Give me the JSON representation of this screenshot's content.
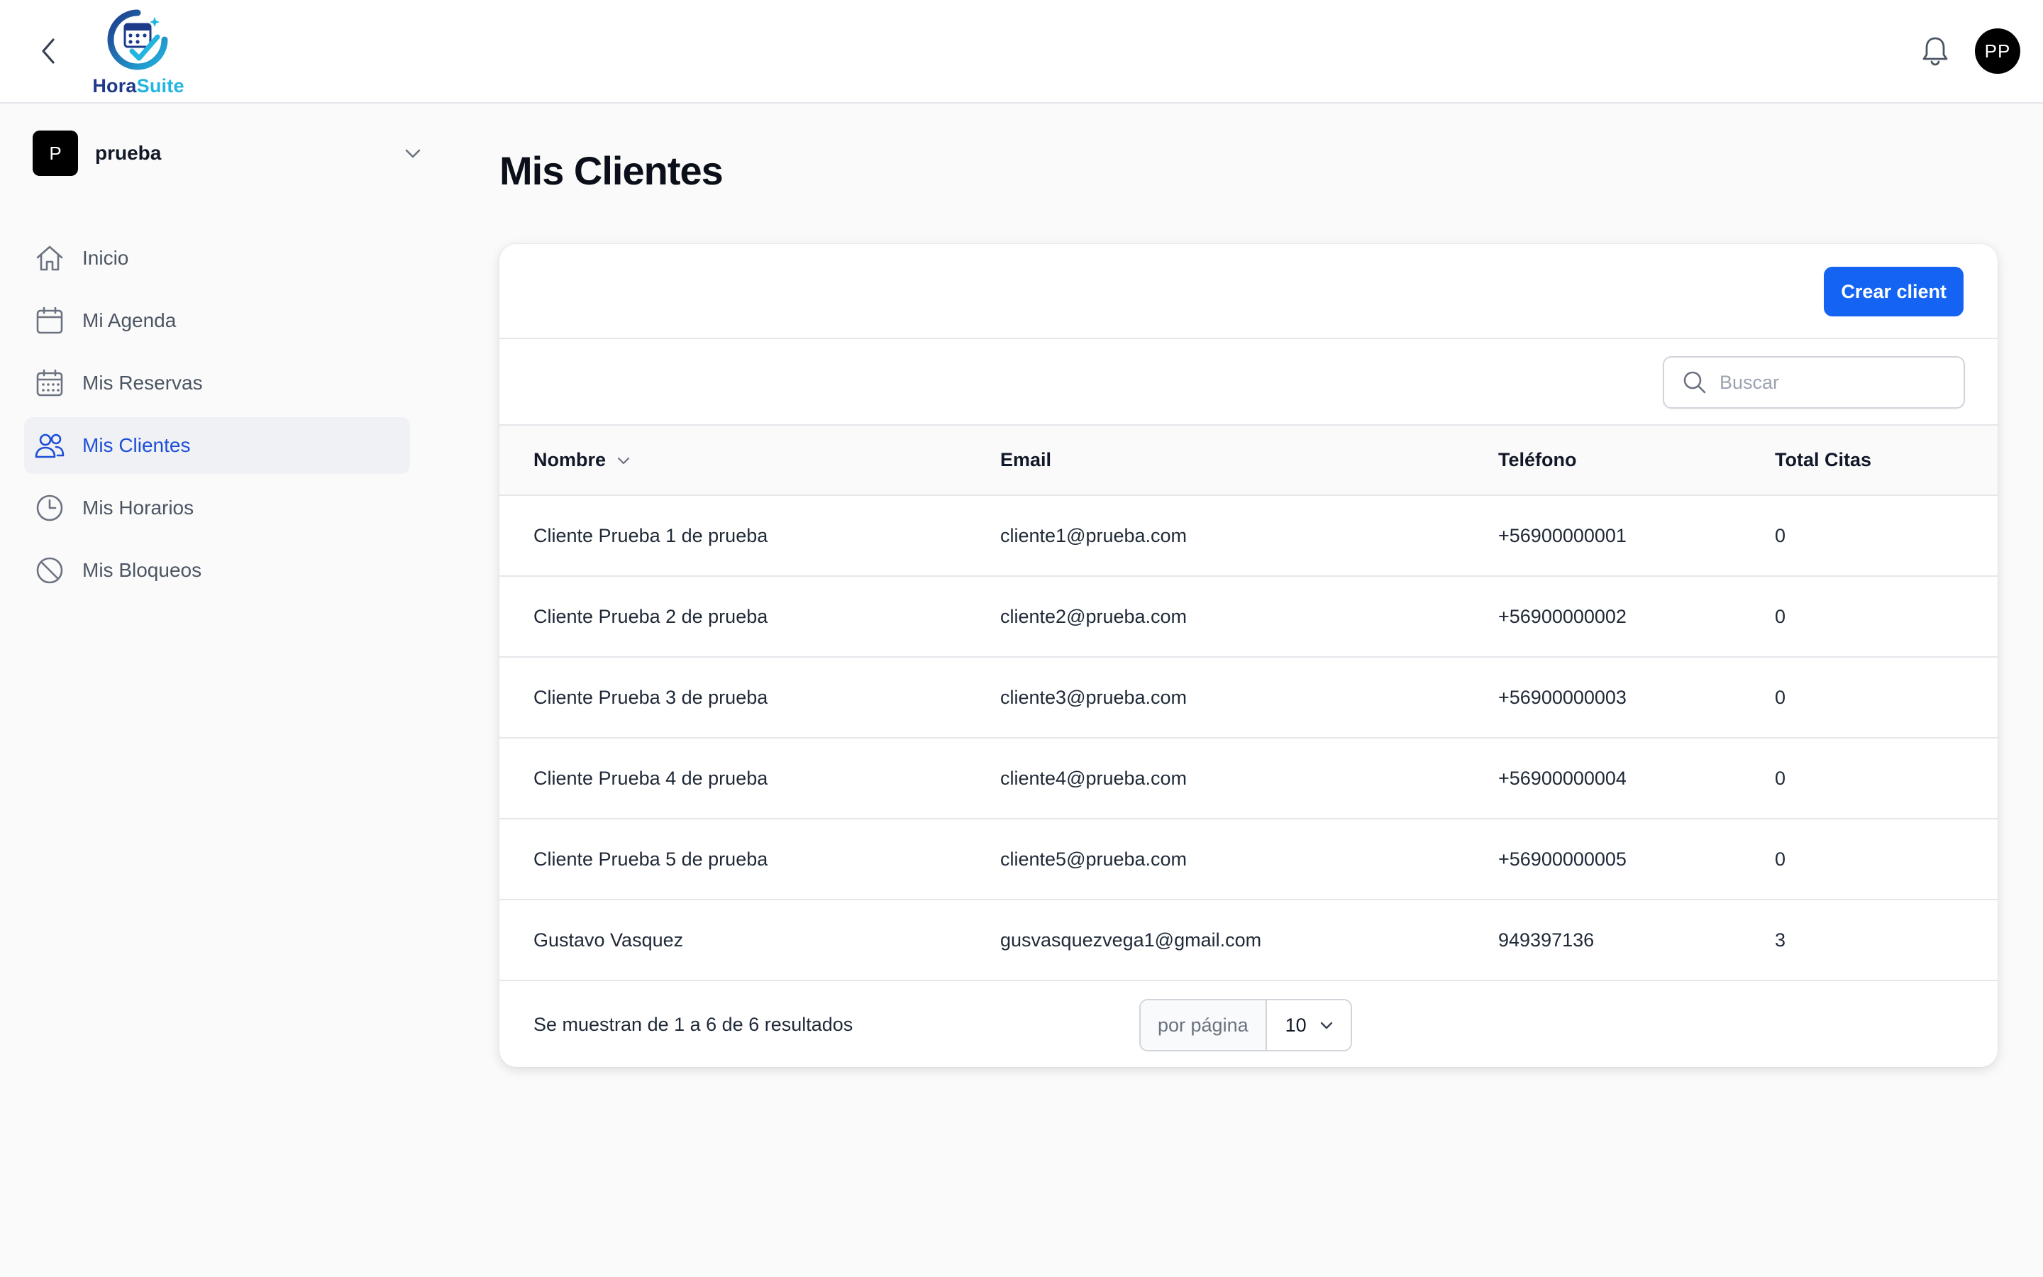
{
  "app": {
    "brand_part1": "Hora",
    "brand_part2": "Suite",
    "user_initials": "PP"
  },
  "colors": {
    "primary": "#1463f3",
    "active_nav": "#1d4ed8",
    "brand_dark": "#1e3a8a",
    "brand_light": "#22b5e0"
  },
  "icons": {
    "back": "chevron-left-icon",
    "notifications": "bell-icon",
    "workspace_toggle": "chevron-down-icon",
    "search": "search-icon",
    "sort": "chevron-down-icon",
    "per_page": "chevron-down-icon"
  },
  "workspace": {
    "initial": "P",
    "name": "prueba"
  },
  "sidebar": {
    "items": [
      {
        "label": "Inicio",
        "icon": "home-icon",
        "active": false
      },
      {
        "label": "Mi Agenda",
        "icon": "calendar-icon",
        "active": false
      },
      {
        "label": "Mis Reservas",
        "icon": "calendar-days-icon",
        "active": false
      },
      {
        "label": "Mis Clientes",
        "icon": "users-icon",
        "active": true
      },
      {
        "label": "Mis Horarios",
        "icon": "clock-icon",
        "active": false
      },
      {
        "label": "Mis Bloqueos",
        "icon": "ban-icon",
        "active": false
      }
    ]
  },
  "main": {
    "title": "Mis Clientes",
    "create_label": "Crear client",
    "search_placeholder": "Buscar",
    "table": {
      "columns": [
        "Nombre",
        "Email",
        "Teléfono",
        "Total Citas"
      ],
      "rows": [
        [
          "Cliente Prueba 1 de prueba",
          "cliente1@prueba.com",
          "+56900000001",
          "0"
        ],
        [
          "Cliente Prueba 2 de prueba",
          "cliente2@prueba.com",
          "+56900000002",
          "0"
        ],
        [
          "Cliente Prueba 3 de prueba",
          "cliente3@prueba.com",
          "+56900000003",
          "0"
        ],
        [
          "Cliente Prueba 4 de prueba",
          "cliente4@prueba.com",
          "+56900000004",
          "0"
        ],
        [
          "Cliente Prueba 5 de prueba",
          "cliente5@prueba.com",
          "+56900000005",
          "0"
        ],
        [
          "Gustavo Vasquez",
          "gusvasquezvega1@gmail.com",
          "949397136",
          "3"
        ]
      ]
    },
    "footer": {
      "results_text": "Se muestran de 1 a 6 de 6 resultados",
      "per_page_label": "por página",
      "per_page_value": "10"
    }
  }
}
